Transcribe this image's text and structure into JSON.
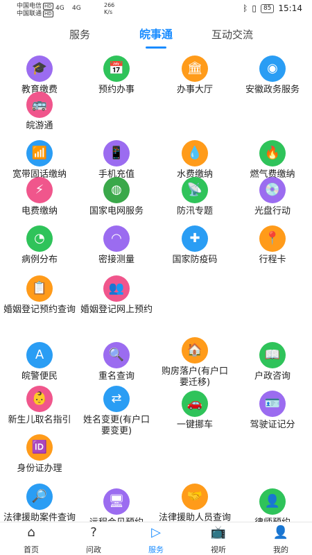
{
  "statusbar": {
    "carrier1": "中国电信",
    "carrier2": "中国联通",
    "hd": "HD",
    "sig1": "4G",
    "sig2": "4G",
    "speed_value": "266",
    "speed_unit": "K/s",
    "battery": "85",
    "time": "15:14"
  },
  "tabs": [
    {
      "label": "服务"
    },
    {
      "label": "皖事通"
    },
    {
      "label": "互动交流"
    }
  ],
  "items": [
    {
      "label": "教育缴费",
      "glyph": "🎓",
      "color": "#9b6cf0",
      "icon": "graduation-cap-icon"
    },
    {
      "label": "预约办事",
      "glyph": "📅",
      "color": "#2fc35a",
      "icon": "calendar-icon"
    },
    {
      "label": "办事大厅",
      "glyph": "🏛",
      "color": "#ff9b1a",
      "icon": "building-icon"
    },
    {
      "label": "安徽政务服务",
      "glyph": "◉",
      "color": "#2a9df4",
      "icon": "gov-logo-icon"
    },
    {
      "label": "皖游通",
      "glyph": "🚌",
      "color": "#f0568c",
      "icon": "bus-icon"
    },
    {
      "label": "宽带固话缴纳",
      "glyph": "📶",
      "color": "#2a9df4",
      "icon": "router-icon"
    },
    {
      "label": "手机充值",
      "glyph": "📱",
      "color": "#9b6cf0",
      "icon": "phone-icon"
    },
    {
      "label": "水费缴纳",
      "glyph": "💧",
      "color": "#ff9b1a",
      "icon": "water-drop-icon"
    },
    {
      "label": "燃气费缴纳",
      "glyph": "🔥",
      "color": "#2fc35a",
      "icon": "flame-icon"
    },
    {
      "label": "电费缴纳",
      "glyph": "⚡",
      "color": "#f0568c",
      "icon": "lightning-icon"
    },
    {
      "label": "国家电网服务",
      "glyph": "◍",
      "color": "#3aa84a",
      "icon": "state-grid-icon"
    },
    {
      "label": "防汛专题",
      "glyph": "📡",
      "color": "#2fc35a",
      "icon": "antenna-icon"
    },
    {
      "label": "光盘行动",
      "glyph": "💿",
      "color": "#9b6cf0",
      "icon": "disc-icon"
    },
    {
      "label": "病例分布",
      "glyph": "◔",
      "color": "#2fc35a",
      "icon": "pie-chart-icon"
    },
    {
      "label": "密接测量",
      "glyph": "◠",
      "color": "#9b6cf0",
      "icon": "gauge-icon"
    },
    {
      "label": "国家防疫码",
      "glyph": "✚",
      "color": "#2a9df4",
      "icon": "shield-code-icon"
    },
    {
      "label": "行程卡",
      "glyph": "📍",
      "color": "#ff9b1a",
      "icon": "location-pin-icon"
    },
    {
      "label": "婚姻登记预约查询",
      "glyph": "📋",
      "color": "#ff9b1a",
      "icon": "marriage-register-icon"
    },
    {
      "label": "婚姻登记网上预约",
      "glyph": "👥",
      "color": "#f0568c",
      "icon": "couple-icon"
    },
    {
      "label": "皖警便民",
      "glyph": "A",
      "color": "#2a9df4",
      "icon": "police-badge-icon"
    },
    {
      "label": "重名查询",
      "glyph": "🔍",
      "color": "#9b6cf0",
      "icon": "name-search-icon"
    },
    {
      "label": "购房落户(有户口要迁移)",
      "glyph": "🏠",
      "color": "#ff9b1a",
      "icon": "house-icon"
    },
    {
      "label": "户政咨询",
      "glyph": "📖",
      "color": "#2fc35a",
      "icon": "household-book-icon"
    },
    {
      "label": "新生儿取名指引",
      "glyph": "👶",
      "color": "#f0568c",
      "icon": "baby-icon"
    },
    {
      "label": "姓名变更(有户口要变更)",
      "glyph": "⇄",
      "color": "#2a9df4",
      "icon": "name-change-icon"
    },
    {
      "label": "一键挪车",
      "glyph": "🚗",
      "color": "#2fc35a",
      "icon": "car-icon"
    },
    {
      "label": "驾驶证记分",
      "glyph": "🪪",
      "color": "#9b6cf0",
      "icon": "license-icon"
    },
    {
      "label": "身份证办理",
      "glyph": "🆔",
      "color": "#ff9b1a",
      "icon": "id-card-icon"
    },
    {
      "label": "法律援助案件查询",
      "glyph": "🔎",
      "color": "#2a9df4",
      "icon": "case-search-icon"
    },
    {
      "label": "远程会见预约",
      "glyph": "🖥",
      "color": "#9b6cf0",
      "icon": "video-meeting-icon"
    },
    {
      "label": "法律援助人员查询",
      "glyph": "🤝",
      "color": "#ff9b1a",
      "icon": "handshake-icon"
    },
    {
      "label": "律师预约",
      "glyph": "👤",
      "color": "#2fc35a",
      "icon": "lawyer-icon"
    }
  ],
  "nav": [
    {
      "label": "首页",
      "glyph": "⌂",
      "icon": "home-icon"
    },
    {
      "label": "问政",
      "glyph": "?",
      "icon": "question-icon"
    },
    {
      "label": "服务",
      "glyph": "▷",
      "icon": "service-icon"
    },
    {
      "label": "视听",
      "glyph": "📺",
      "icon": "tv-icon"
    },
    {
      "label": "我的",
      "glyph": "👤",
      "icon": "profile-icon"
    }
  ]
}
